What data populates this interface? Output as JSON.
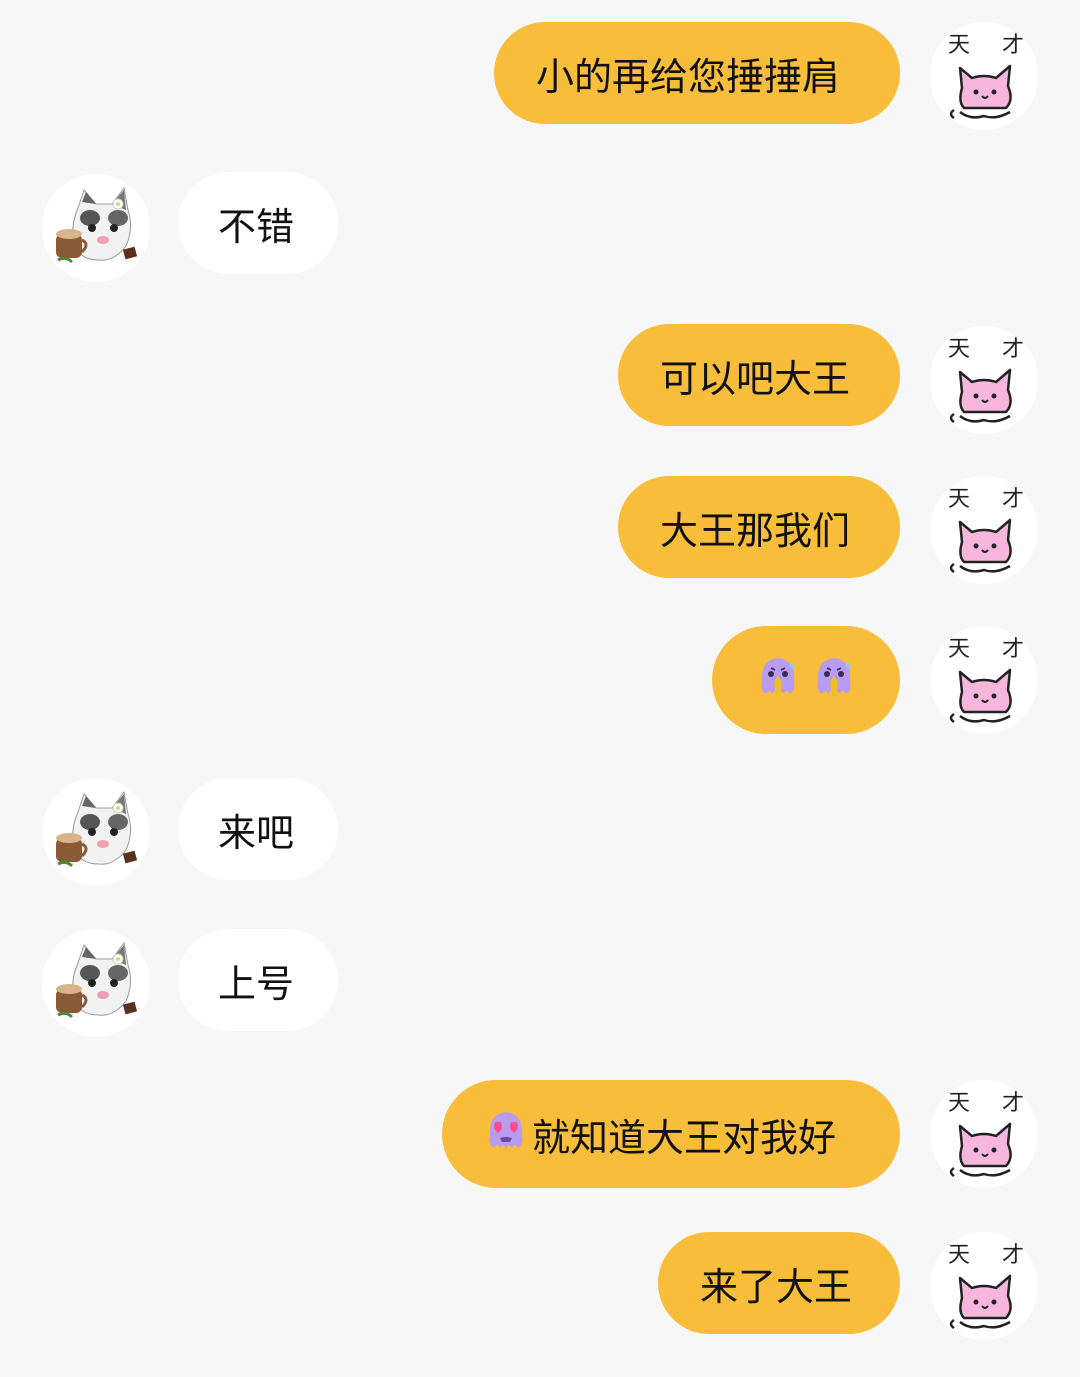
{
  "conversation": {
    "messages": [
      {
        "sender": "me",
        "text": "小的再给您捶捶肩"
      },
      {
        "sender": "them",
        "text": "不错"
      },
      {
        "sender": "me",
        "text": "可以吧大王"
      },
      {
        "sender": "me",
        "text": "大王那我们"
      },
      {
        "sender": "me",
        "emoji": [
          "octopus-sweat-icon",
          "octopus-sweat-icon"
        ]
      },
      {
        "sender": "them",
        "text": "来吧"
      },
      {
        "sender": "them",
        "text": "上号"
      },
      {
        "sender": "me",
        "emoji_prefix": "octopus-heart-eyes-icon",
        "text": "就知道大王对我好"
      },
      {
        "sender": "me",
        "text": "来了大王"
      }
    ]
  },
  "avatars": {
    "me": {
      "icon": "pink-cat-avatar-icon",
      "caption": "天才"
    },
    "them": {
      "icon": "kitten-coffee-avatar-icon"
    }
  },
  "colors": {
    "background": "#f7f7f7",
    "my_bubble": "#f8bd3a",
    "their_bubble": "#ffffff",
    "emoji_octopus": "#b89cf0"
  }
}
